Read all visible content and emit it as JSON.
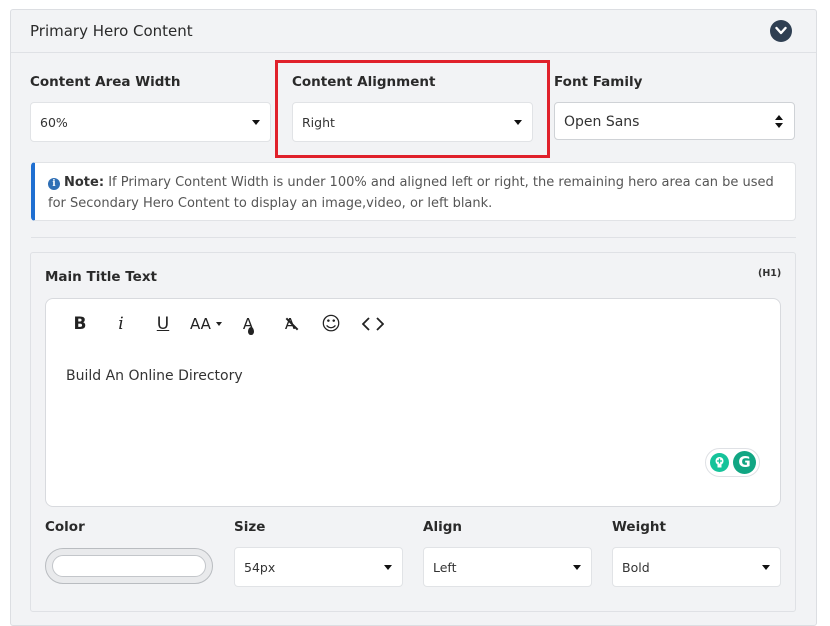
{
  "panel": {
    "title": "Primary Hero Content"
  },
  "content_area_width": {
    "label": "Content Area Width",
    "value": "60%"
  },
  "content_alignment": {
    "label": "Content Alignment",
    "value": "Right"
  },
  "font_family": {
    "label": "Font Family",
    "value": "Open Sans"
  },
  "note": {
    "prefix": "Note:",
    "text": "If Primary Content Width is under 100% and aligned left or right, the remaining hero area can be used for Secondary Hero Content to display an image,video, or left blank."
  },
  "main_title": {
    "label": "Main Title Text",
    "tag": "(H1)",
    "content": "Build An Online Directory",
    "toolbar": {
      "bold": "B",
      "italic": "i",
      "underline": "U",
      "font_size": "AA",
      "font_color": "A",
      "clear_format": "A",
      "emoji": "☺",
      "code": "<>"
    }
  },
  "style_fields": {
    "color": {
      "label": "Color",
      "value": ""
    },
    "size": {
      "label": "Size",
      "value": "54px"
    },
    "align": {
      "label": "Align",
      "value": "Left"
    },
    "weight": {
      "label": "Weight",
      "value": "Bold"
    }
  },
  "colors": {
    "highlight": "#e0212b",
    "note_accent": "#1f6fd1",
    "grammarly": "#15c39a"
  }
}
